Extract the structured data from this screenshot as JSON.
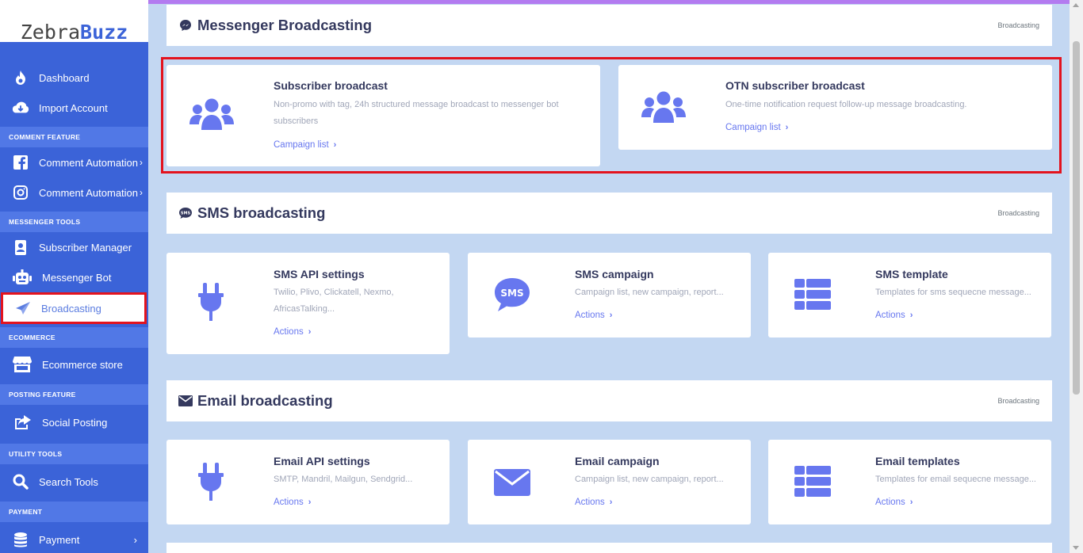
{
  "brand": {
    "part1": "Zebra",
    "part2": "Buzz"
  },
  "sidebar": {
    "items": [
      {
        "label": "Dashboard",
        "icon": "fire-icon"
      },
      {
        "label": "Import Account",
        "icon": "cloud-download-icon"
      }
    ],
    "sections": [
      {
        "title": "COMMENT FEATURE",
        "items": [
          {
            "label": "Comment Automation",
            "icon": "facebook-icon",
            "chevron": "›"
          },
          {
            "label": "Comment Automation",
            "icon": "instagram-icon",
            "chevron": "›"
          }
        ]
      },
      {
        "title": "MESSENGER TOOLS",
        "items": [
          {
            "label": "Subscriber Manager",
            "icon": "contact-book-icon"
          },
          {
            "label": "Messenger Bot",
            "icon": "robot-icon"
          },
          {
            "label": "Broadcasting",
            "icon": "paper-plane-icon"
          }
        ]
      },
      {
        "title": "ECOMMERCE",
        "items": [
          {
            "label": "Ecommerce store",
            "icon": "store-icon"
          }
        ]
      },
      {
        "title": "POSTING FEATURE",
        "items": [
          {
            "label": "Social Posting",
            "icon": "share-icon"
          }
        ]
      },
      {
        "title": "UTILITY TOOLS",
        "items": [
          {
            "label": "Search Tools",
            "icon": "search-icon"
          }
        ]
      },
      {
        "title": "PAYMENT",
        "items": [
          {
            "label": "Payment",
            "icon": "coins-icon",
            "chevron": "›"
          }
        ]
      }
    ]
  },
  "main": {
    "messenger": {
      "title": "Messenger Broadcasting",
      "crumb": "Broadcasting",
      "cards": [
        {
          "title": "Subscriber broadcast",
          "desc1": "Non-promo with tag, 24h structured message broadcast to messenger bot",
          "desc2": "subscribers",
          "link": "Campaign list"
        },
        {
          "title": "OTN subscriber broadcast",
          "desc1": "One-time notification request follow-up message broadcasting.",
          "link": "Campaign list"
        }
      ]
    },
    "sms": {
      "title": "SMS broadcasting",
      "crumb": "Broadcasting",
      "cards": [
        {
          "title": "SMS API settings",
          "desc1": "Twilio, Plivo, Clickatell, Nexmo,",
          "desc2": "AfricasTalking...",
          "link": "Actions"
        },
        {
          "title": "SMS campaign",
          "desc1": "Campaign list, new campaign, report...",
          "link": "Actions"
        },
        {
          "title": "SMS template",
          "desc1": "Templates for sms sequecne message...",
          "link": "Actions"
        }
      ]
    },
    "email": {
      "title": "Email broadcasting",
      "crumb": "Broadcasting",
      "cards": [
        {
          "title": "Email API settings",
          "desc1": "SMTP, Mandril, Mailgun, Sendgrid...",
          "link": "Actions"
        },
        {
          "title": "Email campaign",
          "desc1": "Campaign list, new campaign, report...",
          "link": "Actions"
        },
        {
          "title": "Email templates",
          "desc1": "Templates for email sequecne message...",
          "link": "Actions"
        }
      ]
    },
    "link_chevron": "›"
  },
  "colors": {
    "sidebar": "#3b63d8",
    "section": "#5178e6",
    "accent": "#6777ef",
    "highlight": "#e3131e",
    "background": "#c3d7f2"
  }
}
